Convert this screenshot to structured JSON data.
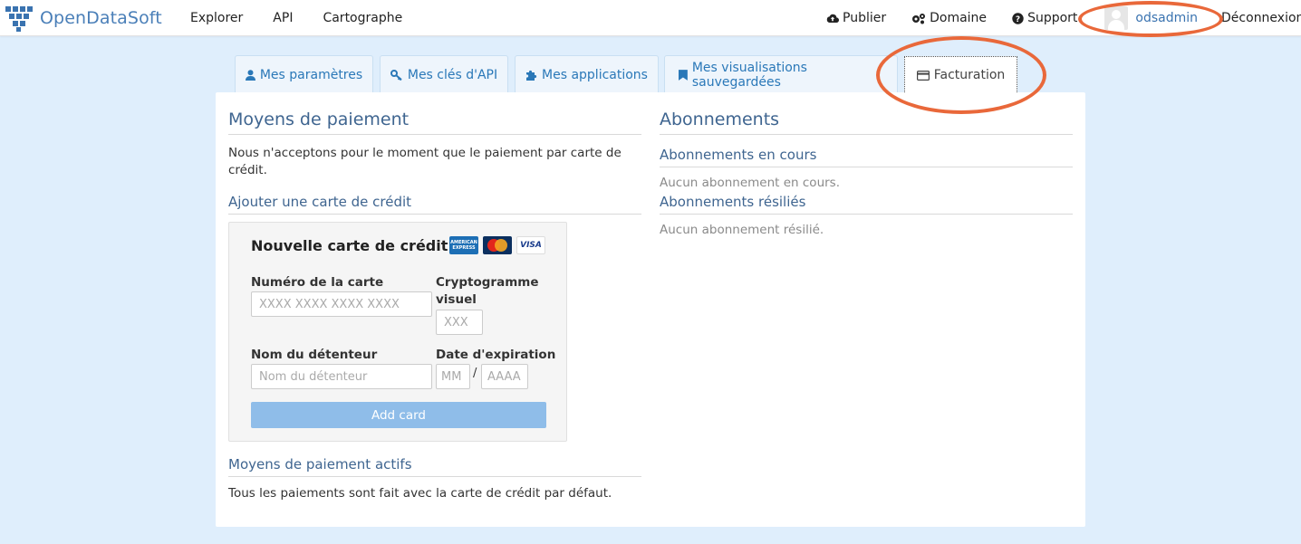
{
  "brand": {
    "name": "OpenDataSoft"
  },
  "nav": {
    "left": [
      "Explorer",
      "API",
      "Cartographe"
    ],
    "publish": "Publier",
    "domain": "Domaine",
    "support": "Support",
    "user": "odsadmin",
    "logout": "Déconnexion"
  },
  "tabs": [
    {
      "label": "Mes paramètres",
      "icon": "user-icon"
    },
    {
      "label": "Mes clés d'API",
      "icon": "key-icon"
    },
    {
      "label": "Mes applications",
      "icon": "puzzle-icon"
    },
    {
      "label": "Mes visualisations sauvegardées",
      "icon": "bookmark-icon"
    },
    {
      "label": "Facturation",
      "icon": "credit-card-icon",
      "active": true
    }
  ],
  "payment": {
    "title": "Moyens de paiement",
    "intro": "Nous n'acceptons pour le moment que le paiement par carte de crédit.",
    "add_card_title": "Ajouter une carte de crédit",
    "form": {
      "title": "Nouvelle carte de crédit",
      "card_number_label": "Numéro de la carte",
      "card_number_placeholder": "XXXX XXXX XXXX XXXX",
      "cvc_label": "Cryptogramme visuel",
      "cvc_placeholder": "XXX",
      "holder_label": "Nom du détenteur",
      "holder_placeholder": "Nom du détenteur",
      "expiry_label": "Date d'expiration",
      "month_placeholder": "MM",
      "year_placeholder": "AAAA",
      "separator": "/",
      "submit": "Add card",
      "brands": [
        "AMERICAN EXPRESS",
        "MasterCard",
        "VISA"
      ]
    },
    "active_title": "Moyens de paiement actifs",
    "active_text": "Tous les paiements sont fait avec la carte de crédit par défaut."
  },
  "subscriptions": {
    "title": "Abonnements",
    "current_title": "Abonnements en cours",
    "current_empty": "Aucun abonnement en cours.",
    "cancelled_title": "Abonnements résiliés",
    "cancelled_empty": "Aucun abonnement résilié."
  },
  "colors": {
    "accent": "#3a73b0",
    "background": "#dfeefc",
    "annotation": "#e9683a",
    "button": "#8fbde9"
  }
}
